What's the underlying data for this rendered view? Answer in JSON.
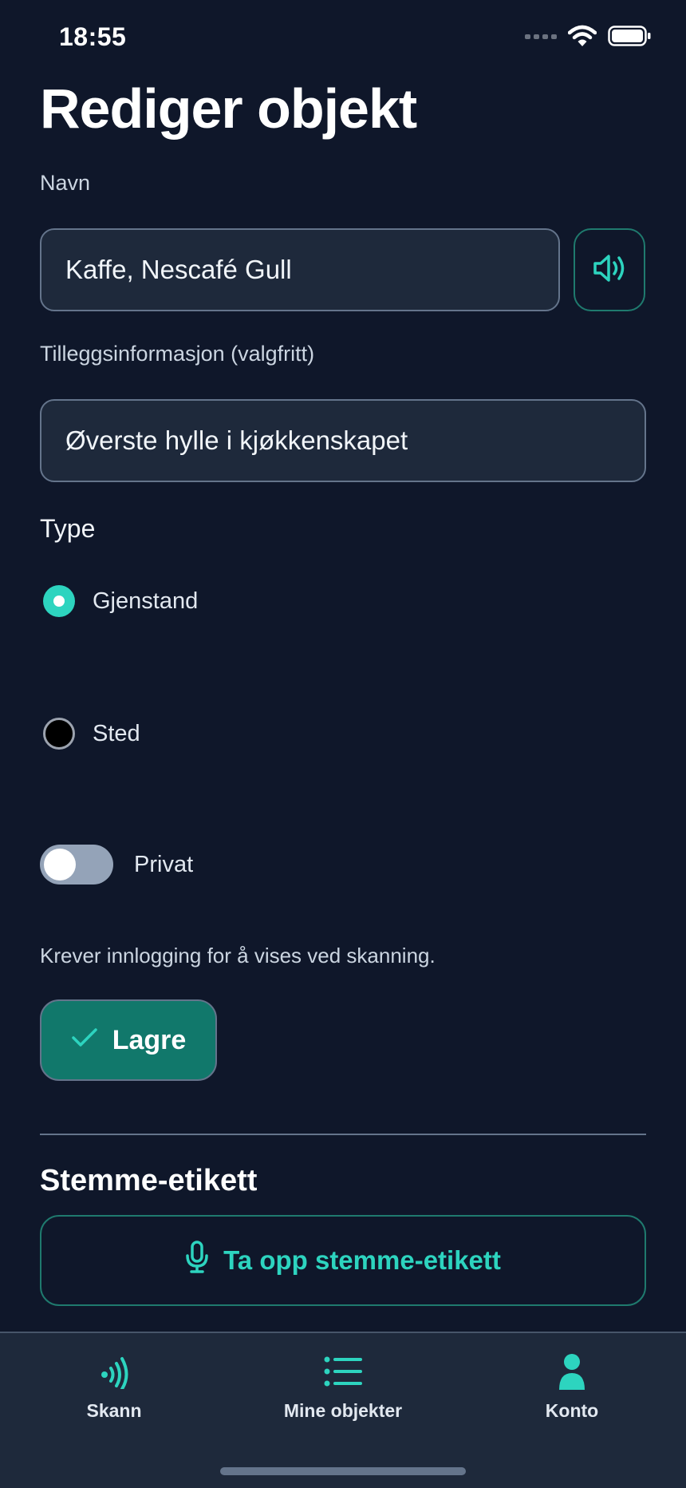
{
  "status_bar": {
    "time": "18:55"
  },
  "page": {
    "title": "Rediger objekt"
  },
  "name_field": {
    "label": "Navn",
    "value": "Kaffe, Nescafé Gull"
  },
  "info_field": {
    "label": "Tilleggsinformasjon (valgfritt)",
    "value": "Øverste hylle i kjøkkenskapet"
  },
  "type": {
    "heading": "Type",
    "options": [
      {
        "label": "Gjenstand",
        "selected": true
      },
      {
        "label": "Sted",
        "selected": false
      }
    ]
  },
  "private_toggle": {
    "label": "Privat",
    "on": false
  },
  "hint": "Krever innlogging for å vises ved skanning.",
  "save_button": {
    "label": "Lagre"
  },
  "voice_section": {
    "title": "Stemme-etikett",
    "record_label": "Ta opp stemme-etikett"
  },
  "tabs": [
    {
      "label": "Skann",
      "icon": "scan-icon"
    },
    {
      "label": "Mine objekter",
      "icon": "list-icon"
    },
    {
      "label": "Konto",
      "icon": "person-icon"
    }
  ],
  "colors": {
    "background": "#0f172a",
    "surface": "#1e293b",
    "accent": "#2dd4bf",
    "primary_button": "#11786b"
  }
}
